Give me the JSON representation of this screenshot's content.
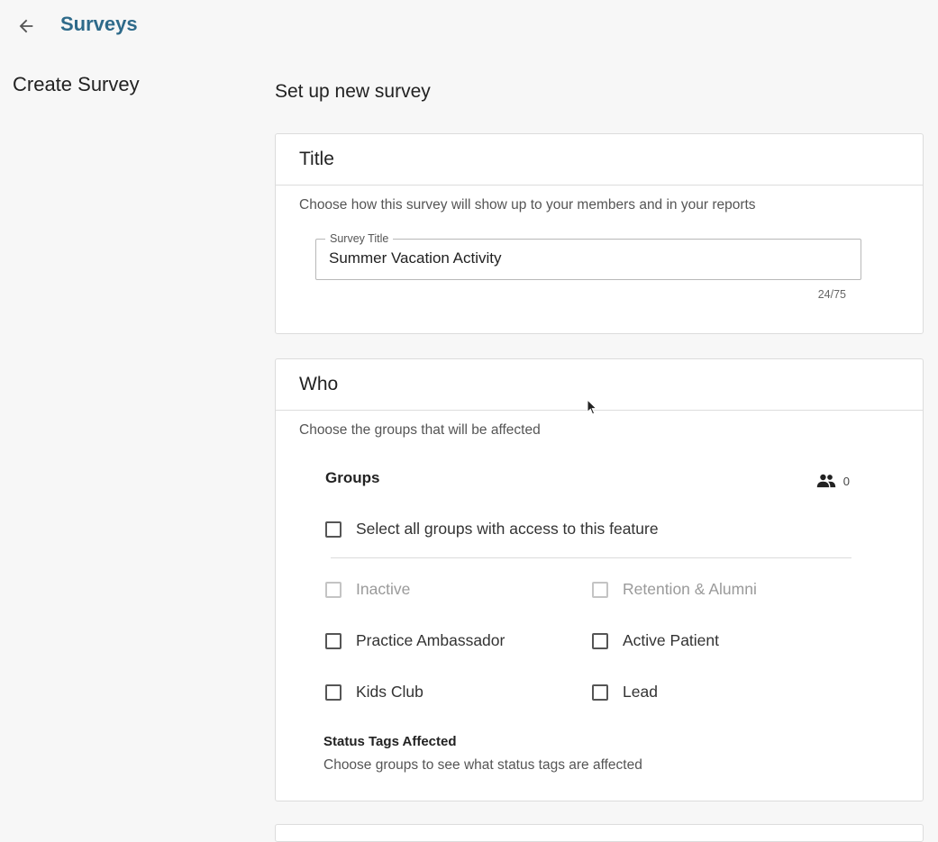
{
  "header": {
    "back_icon": "arrow-left-icon",
    "title": "Surveys"
  },
  "sidebar": {
    "title": "Create Survey"
  },
  "main": {
    "page_title": "Set up new survey",
    "title_section": {
      "heading": "Title",
      "description": "Choose how this survey will show up to your members and in your reports",
      "survey_title_label": "Survey Title",
      "survey_title_value": "Summer Vacation Activity",
      "char_counter": "24/75"
    },
    "who_section": {
      "heading": "Who",
      "description": "Choose the groups that will be affected",
      "groups_title": "Groups",
      "groups_icon": "people-icon",
      "groups_count": "0",
      "select_all_label": "Select all groups with access to this feature",
      "groups": [
        {
          "label": "Inactive",
          "disabled": true,
          "checked": false
        },
        {
          "label": "Retention & Alumni",
          "disabled": true,
          "checked": false
        },
        {
          "label": "Practice Ambassador",
          "disabled": false,
          "checked": false
        },
        {
          "label": "Active Patient",
          "disabled": false,
          "checked": false
        },
        {
          "label": "Kids Club",
          "disabled": false,
          "checked": false
        },
        {
          "label": "Lead",
          "disabled": false,
          "checked": false
        }
      ],
      "status_tags_title": "Status Tags Affected",
      "status_tags_description": "Choose groups to see what status tags are affected"
    }
  },
  "colors": {
    "accent": "#2e6a8a",
    "background": "#f7f7f7",
    "card": "#ffffff",
    "border": "#dcdcdc"
  }
}
